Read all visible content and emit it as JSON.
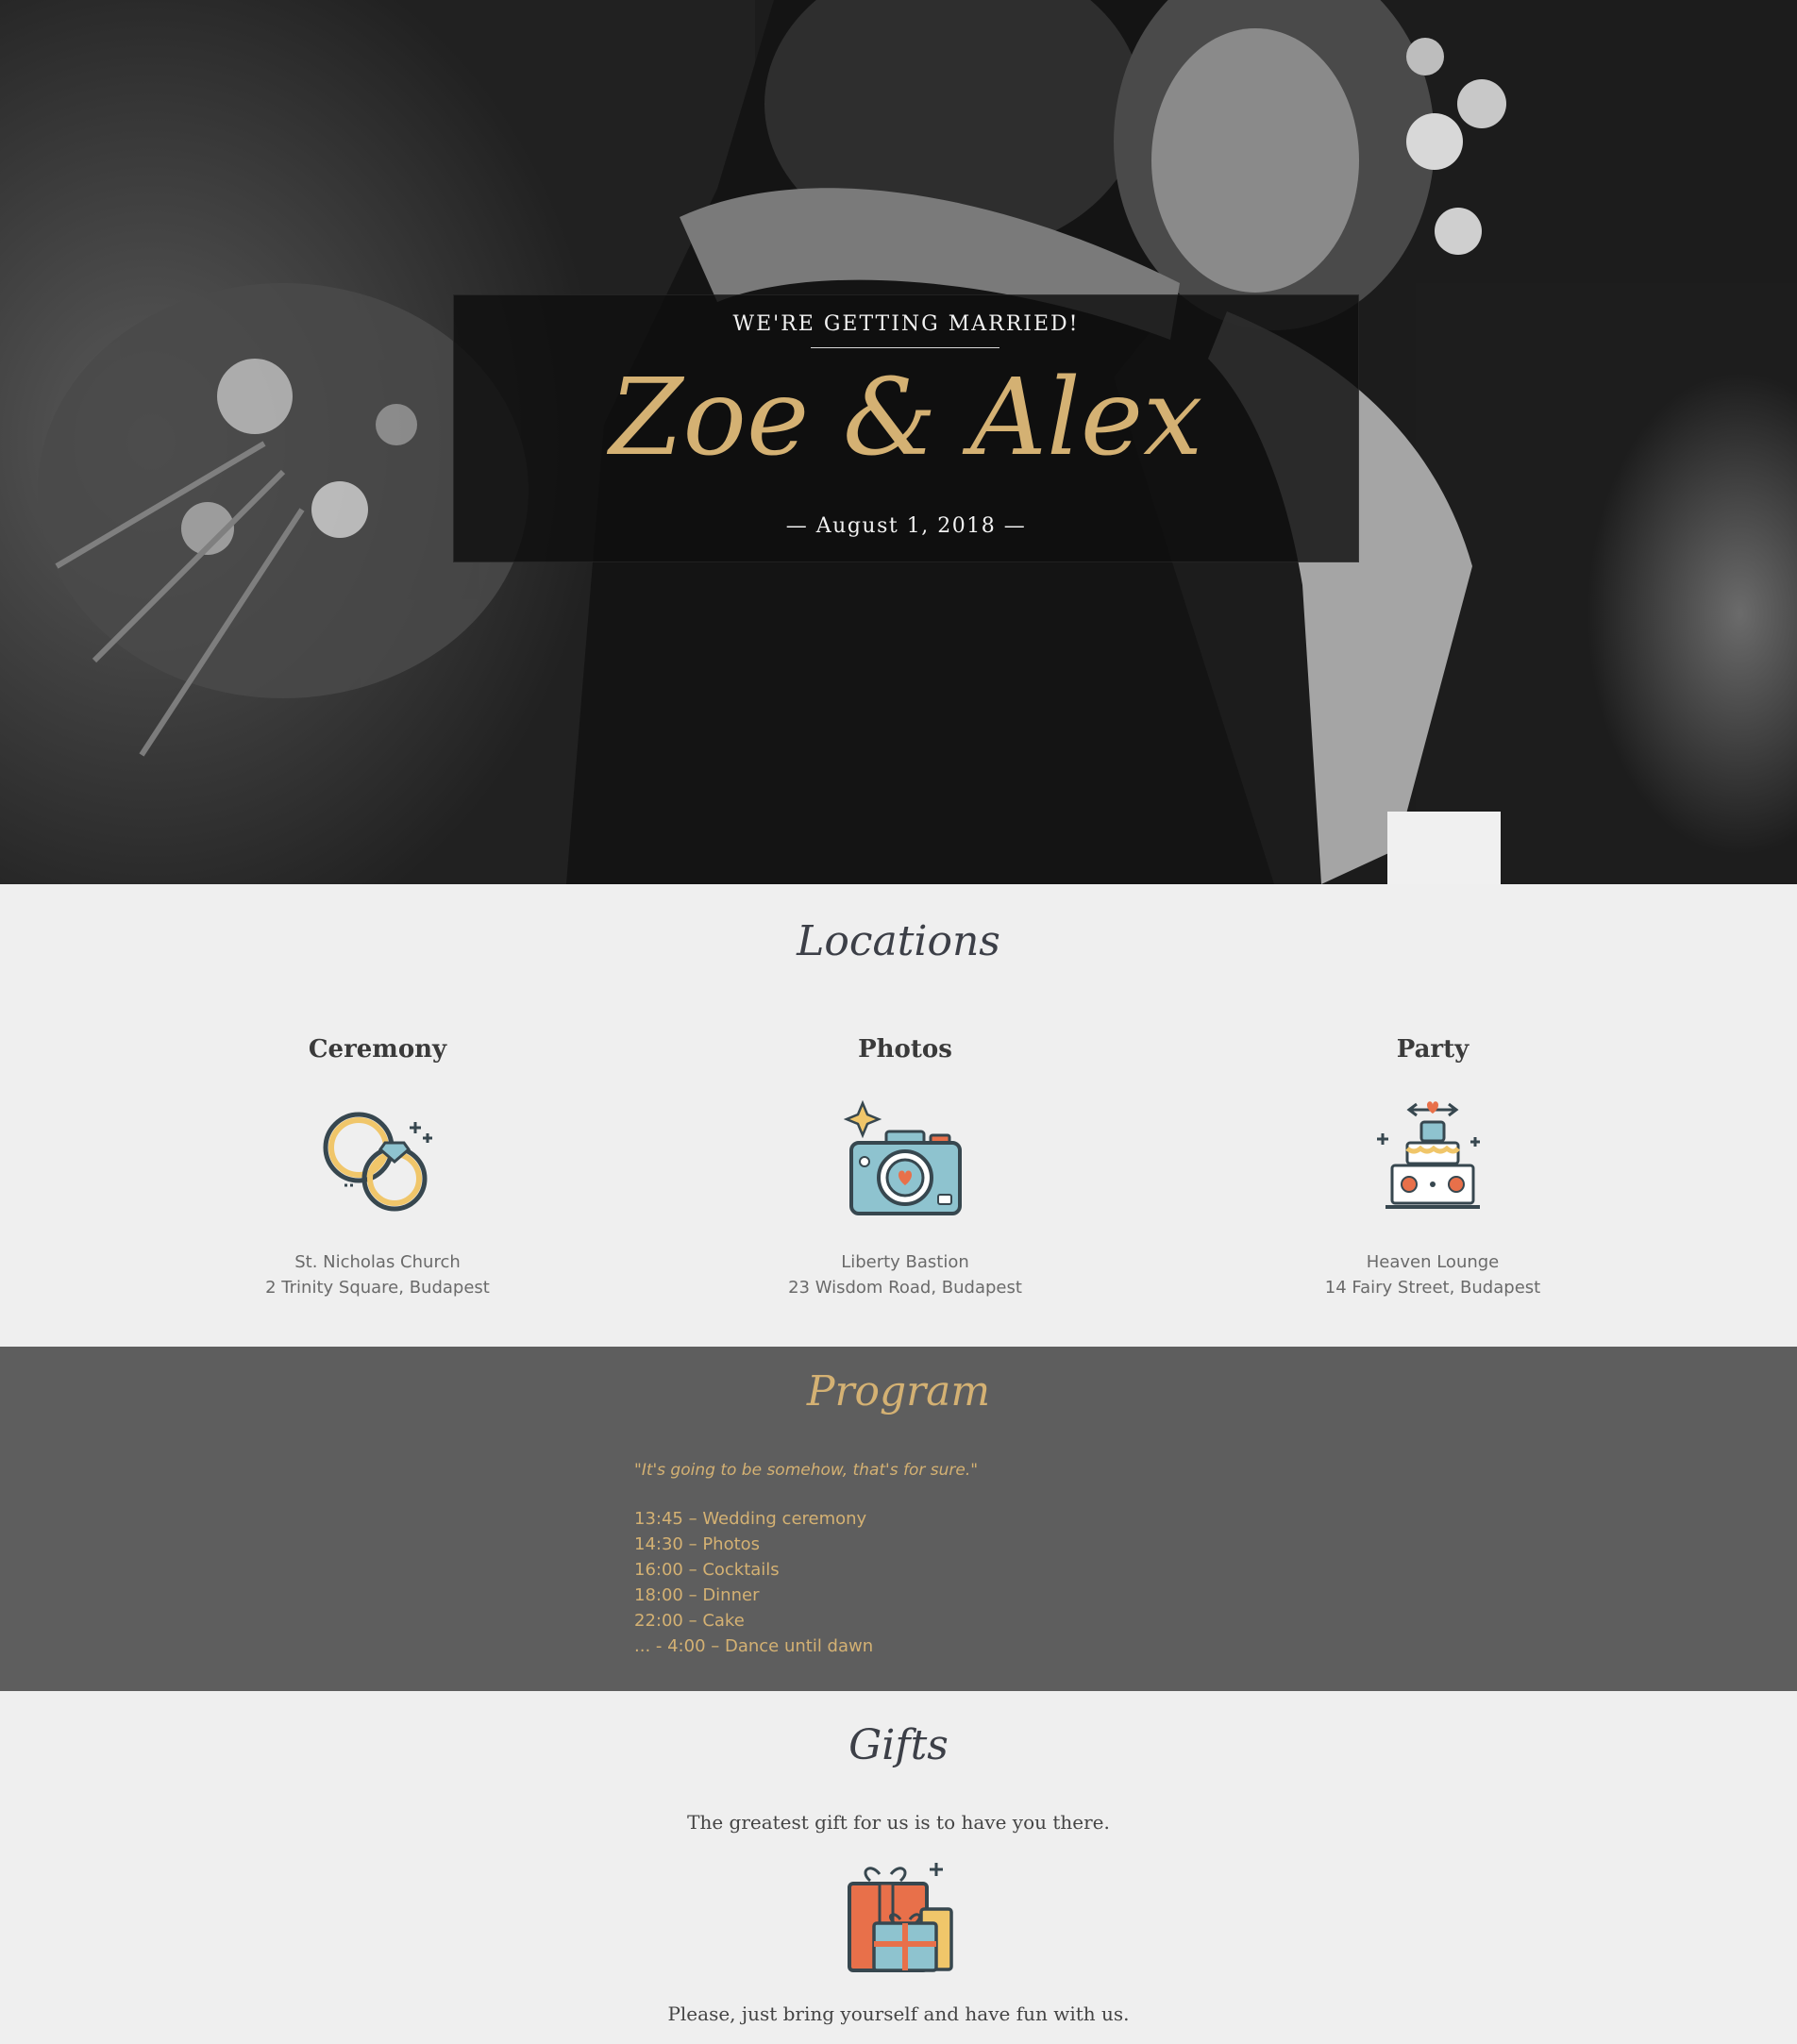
{
  "hero": {
    "kicker": "WE'RE GETTING MARRIED!",
    "names": "Zoe & Alex",
    "date": "— August 1, 2018 —"
  },
  "locations": {
    "title": "Locations",
    "items": [
      {
        "title": "Ceremony",
        "icon": "wedding-rings-icon",
        "name": "St. Nicholas Church",
        "address": "2 Trinity Square, Budapest"
      },
      {
        "title": "Photos",
        "icon": "camera-icon",
        "name": "Liberty Bastion",
        "address": "23 Wisdom Road, Budapest"
      },
      {
        "title": "Party",
        "icon": "wedding-cake-icon",
        "name": "Heaven Lounge",
        "address": "14 Fairy Street, Budapest"
      }
    ]
  },
  "program": {
    "title": "Program",
    "quote": "\"It's going to be somehow, that's for sure.\"",
    "items": [
      "13:45 – Wedding ceremony",
      "14:30 – Photos",
      "16:00 – Cocktails",
      "18:00 – Dinner",
      "22:00 – Cake",
      "... - 4:00 – Dance until dawn"
    ]
  },
  "gifts": {
    "title": "Gifts",
    "line1": "The greatest gift for us is to have you there.",
    "icon": "gift-boxes-icon",
    "line2": "Please, just bring yourself and have fun with us."
  },
  "colors": {
    "gold": "#d4b173",
    "dark_section": "#5e5e5e",
    "light_bg": "#efefef",
    "icon_teal": "#8ec3cf",
    "icon_orange": "#e8704a",
    "icon_yellow": "#f0c66a",
    "icon_outline": "#37474f"
  }
}
